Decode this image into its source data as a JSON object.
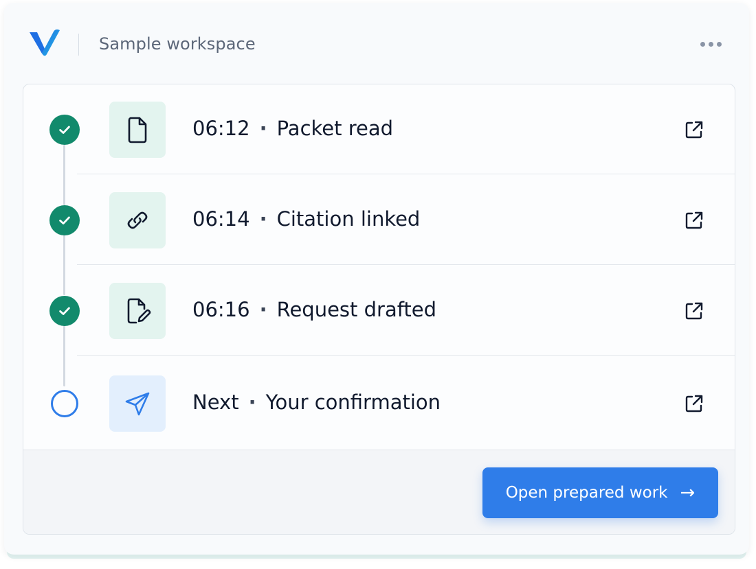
{
  "header": {
    "workspace_title": "Sample workspace",
    "logo_icon": "v-logo-icon",
    "more_icon": "more-horizontal-icon"
  },
  "timeline": [
    {
      "time": "06:12",
      "label": "Packet read",
      "state": "done",
      "icon": "document-icon"
    },
    {
      "time": "06:14",
      "label": "Citation linked",
      "state": "done",
      "icon": "link-icon"
    },
    {
      "time": "06:16",
      "label": "Request drafted",
      "state": "done",
      "icon": "document-edit-icon"
    },
    {
      "time": "Next",
      "label": "Your confirmation",
      "state": "pending",
      "icon": "send-icon"
    }
  ],
  "separator": "·",
  "footer": {
    "cta_label": "Open prepared work",
    "cta_arrow": "→"
  },
  "colors": {
    "accent": "#2f7de9",
    "done": "#128a6c",
    "tile_done": "#e3f4ef",
    "tile_pending": "#e3effd"
  }
}
